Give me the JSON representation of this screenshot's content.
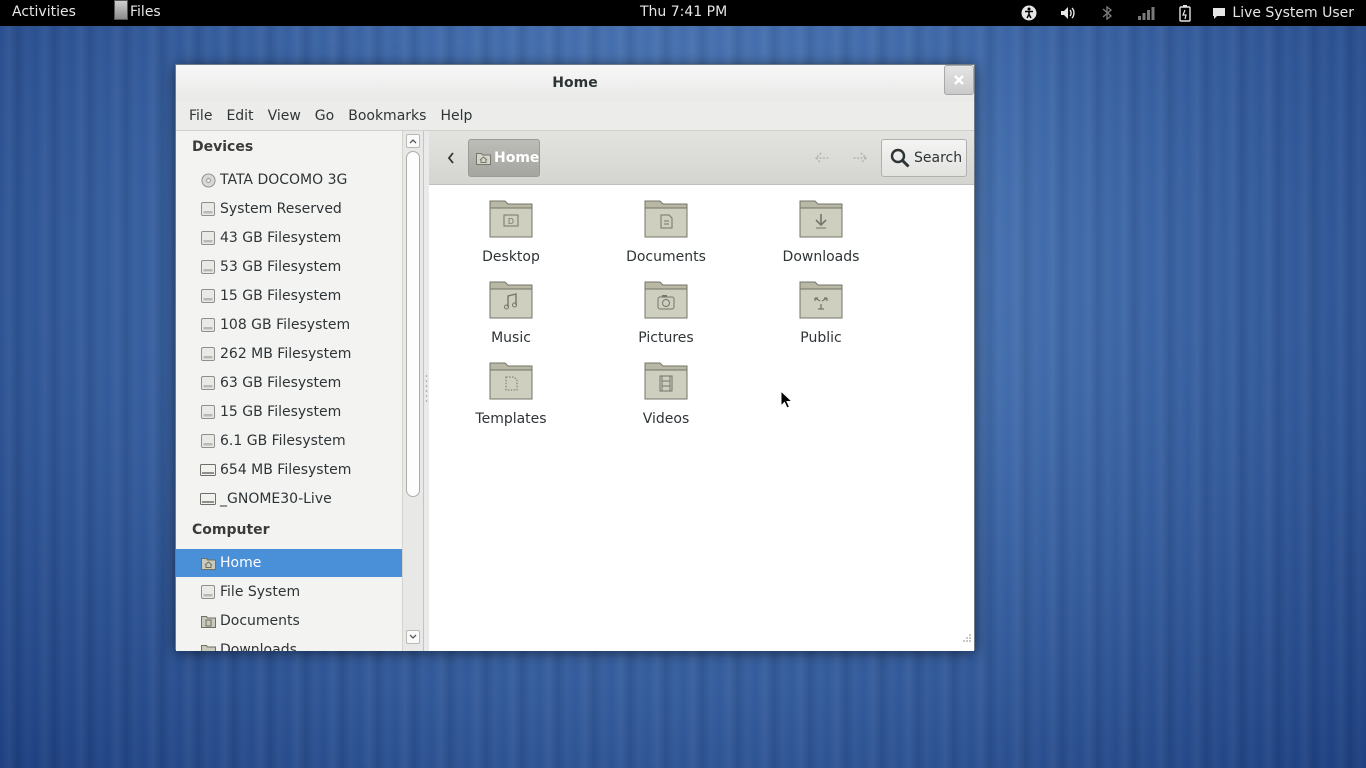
{
  "top_panel": {
    "activities": "Activities",
    "app_name": "Files",
    "clock": "Thu  7:41 PM",
    "user": "Live System User",
    "tray_icons": [
      "accessibility-icon",
      "volume-icon",
      "bluetooth-icon",
      "network-signal-icon",
      "battery-icon"
    ]
  },
  "window": {
    "title": "Home",
    "menu": [
      "File",
      "Edit",
      "View",
      "Go",
      "Bookmarks",
      "Help"
    ]
  },
  "sidebar": {
    "devices_header": "Devices",
    "devices": [
      {
        "label": "TATA DOCOMO 3G",
        "icon": "optical-disc-icon"
      },
      {
        "label": "System Reserved",
        "icon": "drive-icon"
      },
      {
        "label": "43 GB Filesystem",
        "icon": "drive-icon"
      },
      {
        "label": "53 GB Filesystem",
        "icon": "drive-icon"
      },
      {
        "label": "15 GB Filesystem",
        "icon": "drive-icon"
      },
      {
        "label": "108 GB Filesystem",
        "icon": "drive-icon"
      },
      {
        "label": "262 MB Filesystem",
        "icon": "drive-icon"
      },
      {
        "label": "63 GB Filesystem",
        "icon": "drive-icon"
      },
      {
        "label": "15 GB Filesystem",
        "icon": "drive-icon"
      },
      {
        "label": "6.1 GB Filesystem",
        "icon": "drive-icon"
      },
      {
        "label": "654 MB Filesystem",
        "icon": "removable-drive-icon"
      },
      {
        "label": "_GNOME30-Live",
        "icon": "removable-drive-icon"
      }
    ],
    "computer_header": "Computer",
    "computer": [
      {
        "label": "Home",
        "icon": "home-folder-icon",
        "selected": true
      },
      {
        "label": "File System",
        "icon": "drive-icon"
      },
      {
        "label": "Documents",
        "icon": "documents-folder-icon"
      },
      {
        "label": "Downloads",
        "icon": "downloads-folder-icon"
      }
    ]
  },
  "toolbar": {
    "path_home": "Home",
    "search_label": "Search"
  },
  "folders": [
    {
      "label": "Desktop",
      "icon": "desktop-folder-icon"
    },
    {
      "label": "Documents",
      "icon": "documents-folder-icon"
    },
    {
      "label": "Downloads",
      "icon": "downloads-folder-icon"
    },
    {
      "label": "Music",
      "icon": "music-folder-icon"
    },
    {
      "label": "Pictures",
      "icon": "pictures-folder-icon"
    },
    {
      "label": "Public",
      "icon": "public-folder-icon"
    },
    {
      "label": "Templates",
      "icon": "templates-folder-icon"
    },
    {
      "label": "Videos",
      "icon": "videos-folder-icon"
    }
  ],
  "colors": {
    "selection": "#4a90d9",
    "folder_fill": "#b8b8a4",
    "panel": "#000000"
  }
}
